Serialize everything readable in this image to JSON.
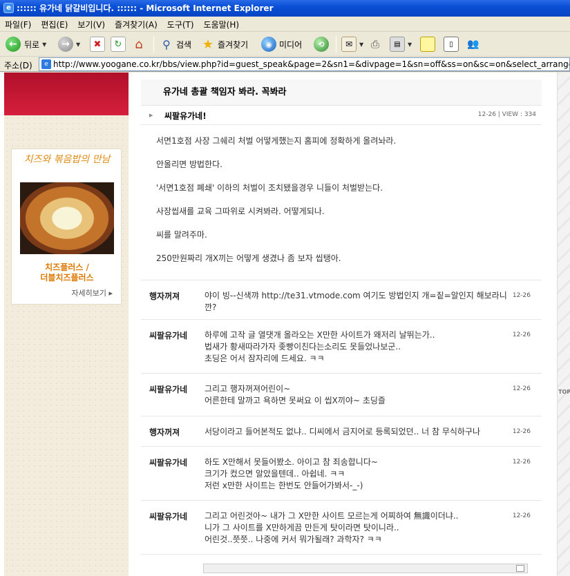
{
  "window": {
    "title": ":::::: 유가네 닭갈비입니다. :::::: - Microsoft Internet Explorer"
  },
  "menu": [
    "파일(F)",
    "편집(E)",
    "보기(V)",
    "즐겨찾기(A)",
    "도구(T)",
    "도움말(H)"
  ],
  "toolbar": {
    "back": "뒤로",
    "search": "검색",
    "favorites": "즐겨찾기",
    "media": "미디어"
  },
  "address": {
    "label": "주소(D)",
    "url": "http://www.yoogane.co.kr/bbs/view.php?id=guest_speak&page=2&sn1=&divpage=1&sn=off&ss=on&sc=on&select_arrange=headnum&de"
  },
  "promo": {
    "script": "치즈와 볶음밥의 만남",
    "title_line1": "치즈플러스 /",
    "title_line2": "더블치즈플러스",
    "more": "자세히보기 ▸"
  },
  "post": {
    "title": "유가네 총괄 책임자 봐라. 꼭봐라",
    "author": "씨팔유가네!",
    "meta": "12-26 | VIEW : 334",
    "lines": [
      "서면1호점 사장 그쉐리 처벌 어떻게했는지 홈피에 정확하게 올려놔라.",
      "안올리면 방법한다.",
      "'서면1호점 폐쇄' 이하의 처벌이 조치됐을경우 니들이 처벌받는다.",
      "사장씹새를 교육 그따위로 시켜봐라. 어떻게되나.",
      "씨를 말려주마.",
      "250만원짜리 개X끼는 어떻게 생겼나 좀 보자 씹탱아."
    ]
  },
  "comments": [
    {
      "name": "행자꺼져",
      "lines": [
        "야이 빙--신색꺄 http://te31.vtmode.com 여기도 방법인지 개=짙=알인지 해보라니깐?"
      ],
      "date": "12-26"
    },
    {
      "name": "씨팔유가네",
      "lines": [
        "하루에 고작 글 열댓개 올라오는 X만한 사이트가 왜저리 날뛰는가..",
        "법새가 황새따라가자 좆빵이친다는소리도 못들었나보군..",
        "초딩은 어서 잠자리에 드세요. ㅋㅋ"
      ],
      "date": "12-26"
    },
    {
      "name": "씨팔유가네",
      "lines": [
        "그리고 행자꺼져어린이~",
        "어른한테 말까고 욕하면 못써요 이 씹X끼야~ 초딩즐"
      ],
      "date": "12-26"
    },
    {
      "name": "행자꺼져",
      "lines": [
        "서당이라고 들어본적도 없냐.. 디씨에서 금지어로 등록되었던.. 너 참 무식하구나"
      ],
      "date": "12-26"
    },
    {
      "name": "씨팔유가네",
      "lines": [
        "하도 X만해서 못들어봤소. 아이고 참 죄송합니다~",
        "크기가 컸으면 알았을텐데.. 아쉽네. ㅋㅋ",
        "저런 x만한 사이트는 한번도 안들어가봐서-_-)"
      ],
      "date": "12-26"
    },
    {
      "name": "씨팔유가네",
      "lines": [
        "그리고 어린것아~ 내가 그 X만한 사이트 모르는게 어찌하여 無識이더냐..",
        "니가 그 사이트를 X만하게끔 만든게 탓이라면 탓이니라..",
        "어린것..쯧쯧.. 나중에 커서 뭐가될래? 과학자? ㅋㅋ"
      ],
      "date": "12-26"
    }
  ],
  "side": {
    "top_label": "TOP"
  }
}
